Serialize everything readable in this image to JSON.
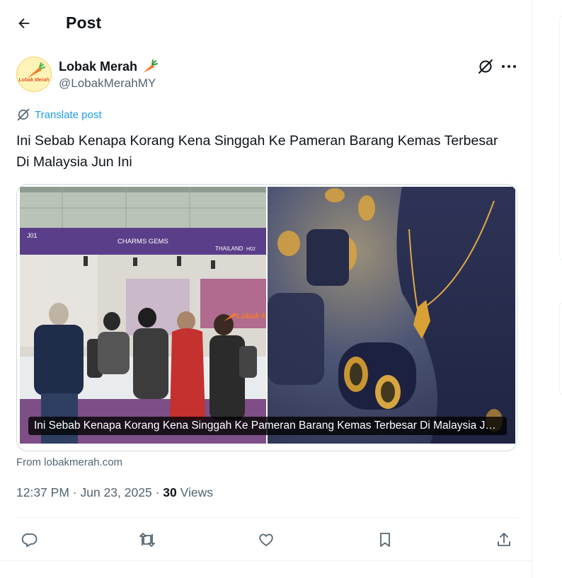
{
  "header": {
    "back_icon": "arrow-left-icon",
    "title": "Post"
  },
  "author": {
    "name": "Lobak Merah",
    "name_emoji": "carrot-icon",
    "handle": "@LobakMerahMY",
    "avatar_text": "Lobak Merah",
    "avatar_colors": {
      "bg": "#fff3b8",
      "accent": "#e4572e",
      "leaf": "#4caf50"
    }
  },
  "post": {
    "translate_label": "Translate post",
    "text": "Ini Sebab Kenapa Korang Kena Singgah Ke Pameran Barang Kemas Terbesar Di Malaysia Jun Ini"
  },
  "card": {
    "caption": "Ini Sebab Kenapa Korang Kena Singgah Ke Pameran Barang Kemas Terbesar Di Malaysia Jun Ini",
    "source": "From lobakmerah.com",
    "left_image": {
      "booth_label_left": "J01",
      "booth_name": "CHARMS GEMS",
      "booth_country": "THAILAND",
      "booth_label_right": "H02",
      "watermark": "Lobak Merah"
    },
    "right_image": {
      "description_icon": "jewelry-display-image"
    }
  },
  "meta": {
    "time": "12:37 PM",
    "sep1": "·",
    "date": "Jun 23, 2025",
    "sep2": "·",
    "views_count": "30",
    "views_label": "Views"
  },
  "actions": {
    "reply_icon": "reply-icon",
    "repost_icon": "repost-icon",
    "like_icon": "heart-icon",
    "bookmark_icon": "bookmark-icon",
    "share_icon": "share-icon"
  },
  "colors": {
    "text": "#0f1419",
    "secondary": "#536471",
    "link": "#1d9bf0",
    "border": "#cfd9de"
  }
}
